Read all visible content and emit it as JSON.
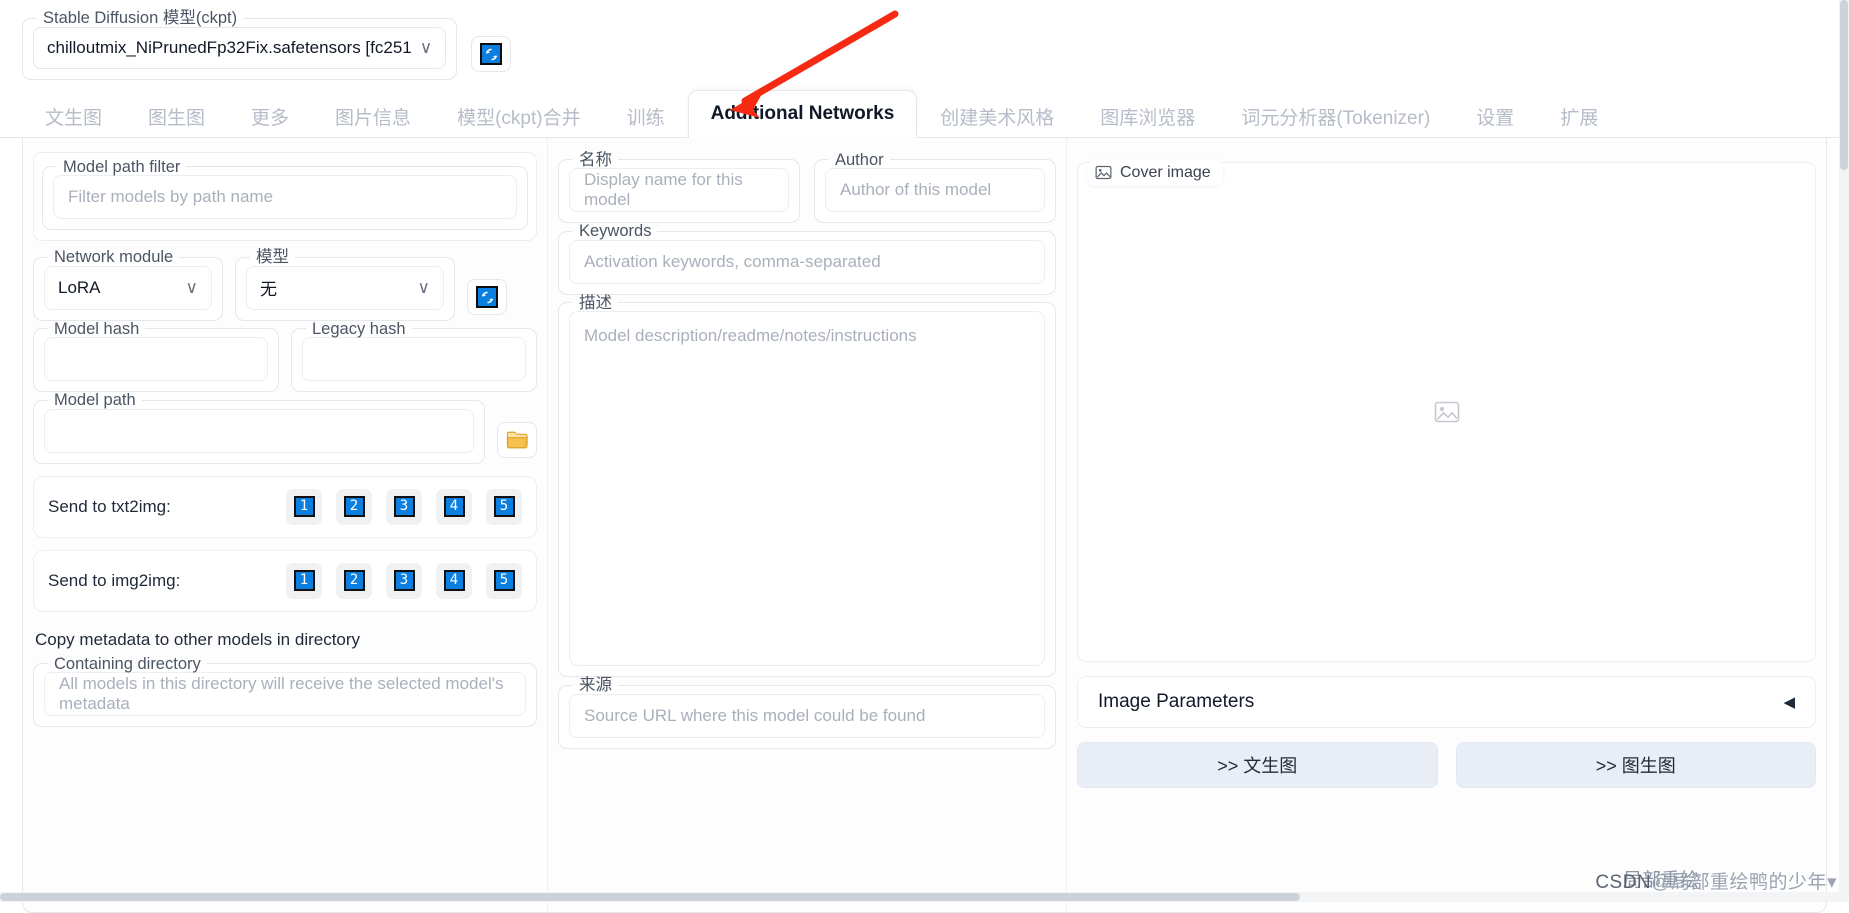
{
  "checkpoint": {
    "legend": "Stable Diffusion 模型(ckpt)",
    "value": "chilloutmix_NiPrunedFp32Fix.safetensors [fc251",
    "chevron": "∨",
    "refresh_icon": "⟳"
  },
  "tabs": [
    {
      "label": "文生图",
      "active": false
    },
    {
      "label": "图生图",
      "active": false
    },
    {
      "label": "更多",
      "active": false
    },
    {
      "label": "图片信息",
      "active": false
    },
    {
      "label": "模型(ckpt)合并",
      "active": false
    },
    {
      "label": "训练",
      "active": false
    },
    {
      "label": "Additional Networks",
      "active": true
    },
    {
      "label": "创建美术风格",
      "active": false
    },
    {
      "label": "图库浏览器",
      "active": false
    },
    {
      "label": "词元分析器(Tokenizer)",
      "active": false
    },
    {
      "label": "设置",
      "active": false
    },
    {
      "label": "扩展",
      "active": false
    }
  ],
  "left": {
    "model_path_filter": {
      "legend": "Model path filter",
      "placeholder": "Filter models by path name"
    },
    "network_module": {
      "legend": "Network module",
      "value": "LoRA",
      "chevron": "∨"
    },
    "model_select": {
      "legend": "模型",
      "value": "无",
      "chevron": "∨"
    },
    "refresh_icon": "⟳",
    "model_hash": {
      "legend": "Model hash",
      "value": ""
    },
    "legacy_hash": {
      "legend": "Legacy hash",
      "value": ""
    },
    "model_path": {
      "legend": "Model path",
      "value": ""
    },
    "folder_icon": "📁",
    "send_txt2img": {
      "label": "Send to txt2img:",
      "buttons": [
        "1",
        "2",
        "3",
        "4",
        "5"
      ]
    },
    "send_img2img": {
      "label": "Send to img2img:",
      "buttons": [
        "1",
        "2",
        "3",
        "4",
        "5"
      ]
    },
    "copy_metadata_title": "Copy metadata to other models in directory",
    "containing_directory": {
      "legend": "Containing directory",
      "placeholder": "All models in this directory will receive the selected model's metadata"
    }
  },
  "middle": {
    "name": {
      "legend": "名称",
      "placeholder": "Display name for this model"
    },
    "author": {
      "legend": "Author",
      "placeholder": "Author of this model"
    },
    "keywords": {
      "legend": "Keywords",
      "placeholder": "Activation keywords, comma-separated"
    },
    "description": {
      "legend": "描述",
      "placeholder": "Model description/readme/notes/instructions"
    },
    "source": {
      "legend": "来源",
      "placeholder": "Source URL where this model could be found"
    }
  },
  "right": {
    "cover_image": {
      "label": "Cover image",
      "icon": "image-icon",
      "placeholder_icon": "🖼"
    },
    "image_parameters": {
      "label": "Image Parameters",
      "caret": "◀"
    },
    "send_buttons": [
      {
        "label": ">> 文生图"
      },
      {
        "label": ">> 图生图"
      }
    ]
  },
  "annotations": {
    "arrow_color": "#f62a12"
  },
  "watermark": {
    "prefix": "CSDN",
    "overlay": "局部重绘",
    "suffix": "@局部重绘鸭的少年",
    "caret": "▾"
  },
  "colors": {
    "accent": "#0b7fe0",
    "tab_inactive": "#b6bcc8",
    "border": "#e5e7eb"
  }
}
